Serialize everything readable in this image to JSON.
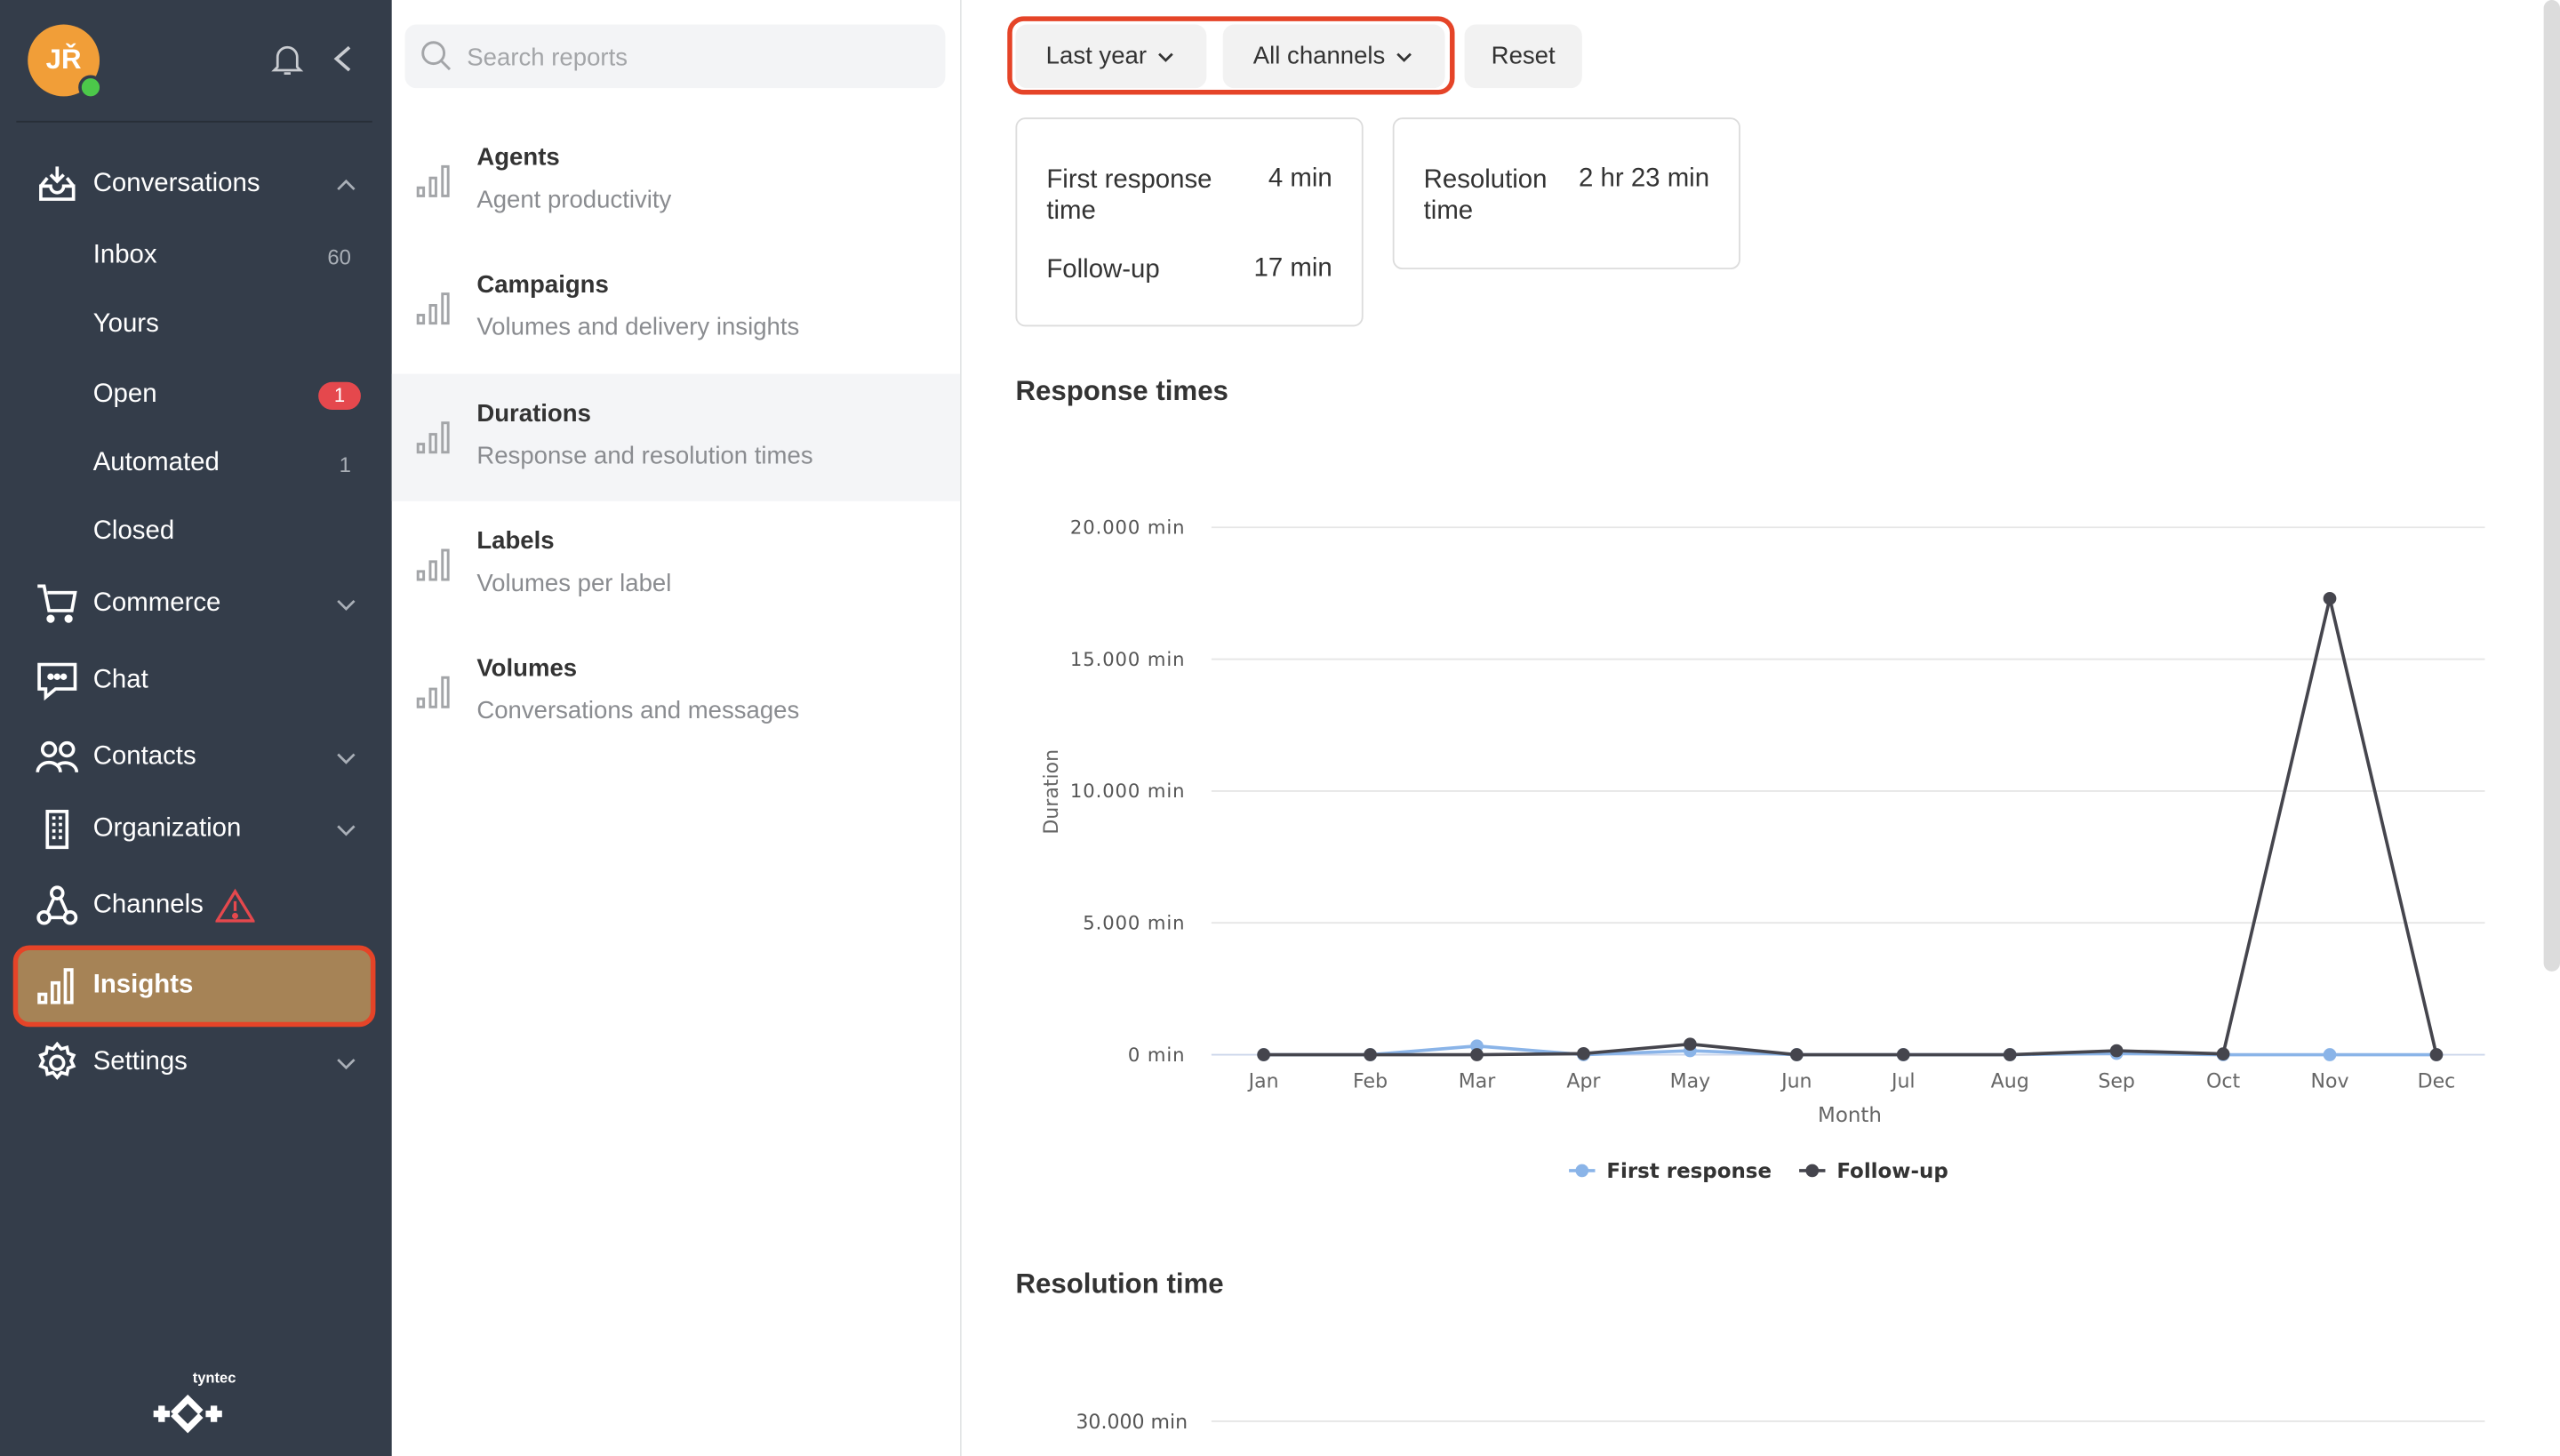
{
  "sidebar": {
    "user_initials": "JŘ",
    "presence": "online",
    "items": [
      {
        "label": "Conversations",
        "icon": "inbox-download-icon",
        "expanded": true
      },
      {
        "label": "Commerce",
        "icon": "cart-icon"
      },
      {
        "label": "Chat",
        "icon": "chat-bubble-icon"
      },
      {
        "label": "Contacts",
        "icon": "people-icon"
      },
      {
        "label": "Organization",
        "icon": "building-icon"
      },
      {
        "label": "Channels",
        "icon": "channels-icon",
        "warning": true
      },
      {
        "label": "Insights",
        "icon": "bar-chart-icon",
        "active": true
      },
      {
        "label": "Settings",
        "icon": "gear-icon"
      }
    ],
    "conversation_subitems": [
      {
        "label": "Inbox",
        "count": "60"
      },
      {
        "label": "Yours",
        "count": ""
      },
      {
        "label": "Open",
        "badge": "1"
      },
      {
        "label": "Automated",
        "count": "1"
      },
      {
        "label": "Closed",
        "count": ""
      }
    ],
    "logo_text": "tyntec"
  },
  "reports": {
    "search_placeholder": "Search reports",
    "items": [
      {
        "title": "Agents",
        "subtitle": "Agent productivity"
      },
      {
        "title": "Campaigns",
        "subtitle": "Volumes and delivery insights"
      },
      {
        "title": "Durations",
        "subtitle": "Response and resolution times",
        "selected": true
      },
      {
        "title": "Labels",
        "subtitle": "Volumes per label"
      },
      {
        "title": "Volumes",
        "subtitle": "Conversations and messages"
      }
    ]
  },
  "filters": {
    "period": "Last year",
    "channel": "All channels",
    "reset": "Reset"
  },
  "summary": {
    "response_card": {
      "first_response_label": "First response time",
      "first_response_value": "4 min",
      "follow_up_label": "Follow-up",
      "follow_up_value": "17 min"
    },
    "resolution_card": {
      "label": "Resolution time",
      "value": "2 hr 23 min"
    }
  },
  "sections": {
    "response_times_title": "Response times",
    "resolution_time_title": "Resolution time",
    "resolution_first_tick": "30.000 min"
  },
  "colors": {
    "accent_active": "#a68356",
    "highlight_outline": "#e54428",
    "first_response": "#8ab4e8",
    "follow_up": "#45454d",
    "sidebar_bg": "#343d4a",
    "badge_red": "#e5484d"
  },
  "chart_data": {
    "type": "line",
    "title": "Response times",
    "xlabel": "Month",
    "ylabel": "Duration",
    "categories": [
      "Jan",
      "Feb",
      "Mar",
      "Apr",
      "May",
      "Jun",
      "Jul",
      "Aug",
      "Sep",
      "Oct",
      "Nov",
      "Dec"
    ],
    "y_ticks": [
      "0 min",
      "5.000 min",
      "10.000 min",
      "15.000 min",
      "20.000 min"
    ],
    "y_tick_values": [
      0,
      5000,
      10000,
      15000,
      20000
    ],
    "ylim": [
      0,
      20000
    ],
    "grid": true,
    "legend_position": "bottom-center",
    "series": [
      {
        "name": "First response",
        "color": "#8ab4e8",
        "values": [
          0,
          0,
          330,
          0,
          150,
          0,
          0,
          0,
          50,
          0,
          0,
          0
        ]
      },
      {
        "name": "Follow-up",
        "color": "#45454d",
        "values": [
          0,
          0,
          0,
          40,
          400,
          0,
          0,
          0,
          150,
          30,
          17300,
          0
        ]
      }
    ]
  }
}
